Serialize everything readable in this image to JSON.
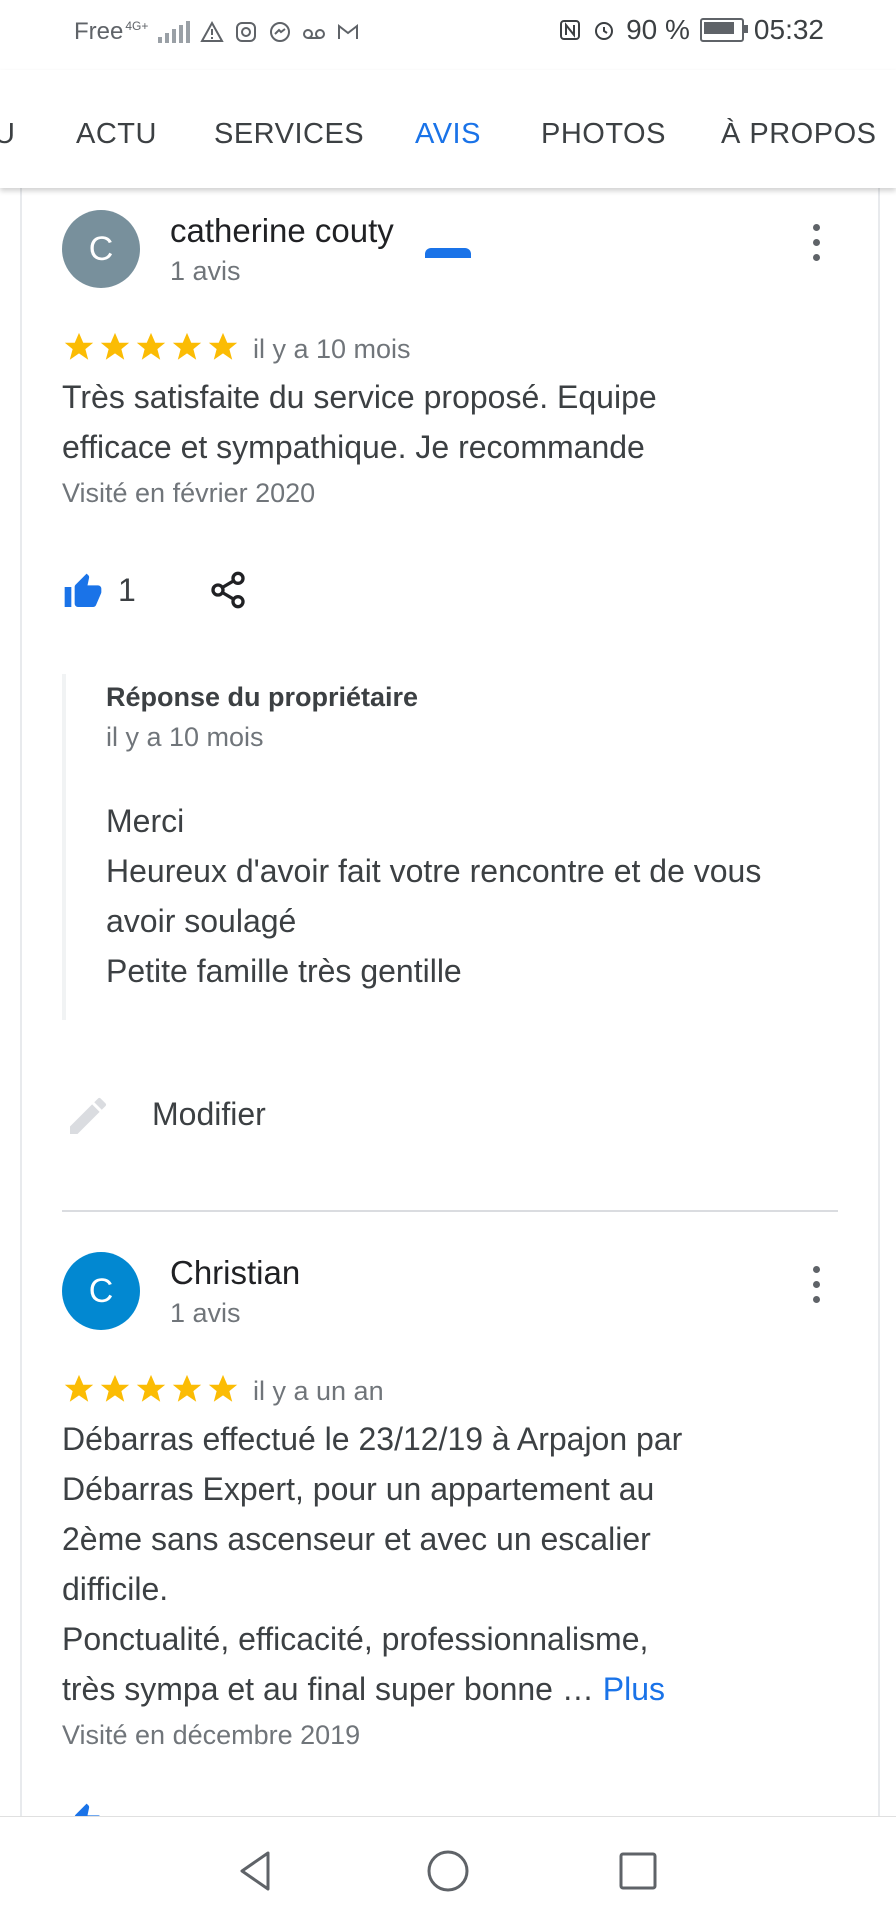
{
  "status_bar": {
    "carrier": "Free",
    "network": "4G+",
    "battery": "90 %",
    "time": "05:32"
  },
  "tabs": [
    {
      "label": "U"
    },
    {
      "label": "ACTU"
    },
    {
      "label": "SERVICES"
    },
    {
      "label": "AVIS",
      "active": true
    },
    {
      "label": "PHOTOS"
    },
    {
      "label": "À PROPOS"
    }
  ],
  "reviews": [
    {
      "initial": "C",
      "avatar_color": "#78909c",
      "name": "catherine couty",
      "count": "1 avis",
      "rating": 5,
      "time": "il y a 10 mois",
      "text": "Très satisfaite du service proposé. Equipe\nefficace et sympathique. Je recommande",
      "visited": "Visité en février 2020",
      "likes": "1",
      "owner_reply": {
        "title": "Réponse du propriétaire",
        "time": "il y a 10 mois",
        "text": "Merci\nHeureux d'avoir fait votre rencontre et de vous\navoir soulagé\nPetite famille très gentille"
      },
      "edit_label": "Modifier"
    },
    {
      "initial": "C",
      "avatar_color": "#0288d1",
      "name": "Christian",
      "count": "1 avis",
      "rating": 5,
      "time": "il y a un an",
      "text": "Débarras effectué le 23/12/19 à Arpajon par\nDébarras Expert, pour un appartement au\n2ème sans ascenseur et avec un escalier\ndifficile.\nPonctualité, efficacité, professionnalisme,\ntrès sympa et au final super bonne … ",
      "more_label": "Plus",
      "visited": "Visité en décembre 2019"
    }
  ],
  "colors": {
    "accent": "#1a73e8",
    "star": "#fbbc04"
  }
}
